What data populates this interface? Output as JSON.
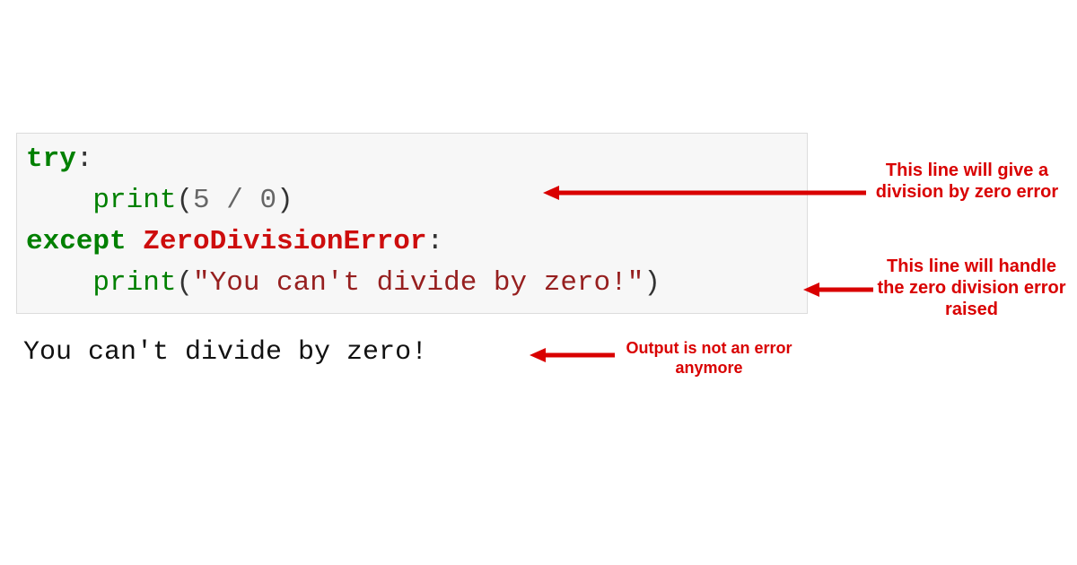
{
  "code": {
    "line1": {
      "try_kw": "try",
      "colon": ":"
    },
    "line2": {
      "indent": "    ",
      "print_fn": "print",
      "open": "(",
      "num5": "5",
      "space1": " ",
      "div": "/",
      "space2": " ",
      "num0": "0",
      "close": ")"
    },
    "line3": {
      "except_kw": "except",
      "space": " ",
      "exc_name": "ZeroDivisionError",
      "colon": ":"
    },
    "line4": {
      "indent": "    ",
      "print_fn": "print",
      "open": "(",
      "string": "\"You can't divide by zero!\"",
      "close": ")"
    }
  },
  "output": "You can't divide by zero!",
  "annotations": {
    "ann1": "This line will give a division by zero error",
    "ann2": "This line will handle the zero division error raised",
    "ann3": "Output is not an error anymore"
  },
  "colors": {
    "annotation": "#d90000",
    "code_bg": "#f7f7f7",
    "keyword": "#008000",
    "exception": "#cd0d0d",
    "string": "#961f1f",
    "number": "#666666"
  }
}
